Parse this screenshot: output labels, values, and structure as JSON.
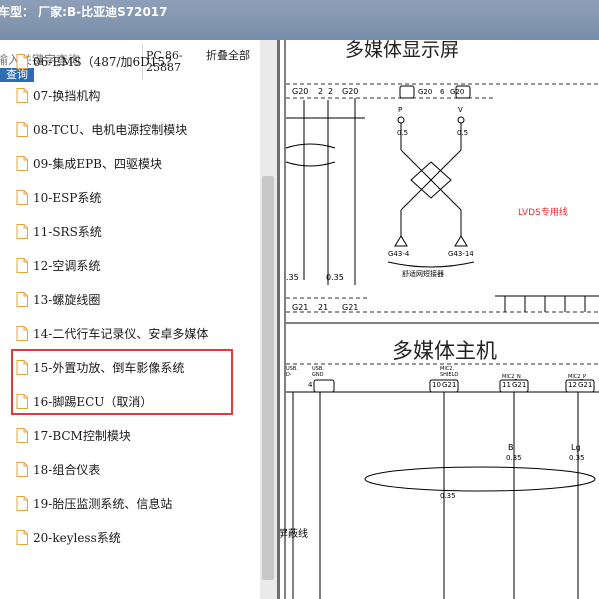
{
  "window": {
    "title": "车型：  厂家:B-比亚迪S72017"
  },
  "search": {
    "placeholder": "输入关键字查询",
    "button_label": "查询"
  },
  "header": {
    "pc_code": "PC.86-25887",
    "collapse_label": "折叠全部"
  },
  "list_items": [
    "06-EMS（487/加6D15?",
    "07-换挡机构",
    "08-TCU、电机电源控制模块",
    "09-集成EPB、四驱模块",
    "10-ESP系统",
    "11-SRS系统",
    "12-空调系统",
    "13-螺旋线圈",
    "14-二代行车记录仪、安卓多媒体",
    "15-外置功放、倒车影像系统",
    "16-脚踢ECU（取消）",
    "17-BCM控制模块",
    "18-组合仪表",
    "19-胎压监测系统、信息站",
    "20-keyless系统"
  ],
  "diagram": {
    "display_title": "多媒体显示屏",
    "host_title": "多媒体主机",
    "lvds_label": "LVDS专用线",
    "connector_left_a": "G20",
    "connector_left_b": "G20",
    "pin_2a": "2",
    "pin_2b": "2",
    "pin_p": "P",
    "pin_v": "V",
    "pin_g20_6": "G20",
    "pin_6": "6",
    "pin_g20_2": "G20",
    "wire_05_a": "0.5",
    "wire_05_b": "0.5",
    "ground_a": "G43-4",
    "ground_b": "G43-14",
    "ground_caption": "舒适网短接器",
    "wire_35_left": ".35",
    "wire_035": "0.35",
    "g21_left": "G21",
    "g21_right": "G21",
    "pin_21": "21",
    "usb_left": "USB.",
    "usb_left_b": "D-",
    "usb_gnd": "USB.",
    "usb_gnd_b": "GND",
    "pin_4": "4",
    "mic_shield": "MIC2.",
    "mic_shield_b": "SHIELD",
    "mic_n": "MIC2_N",
    "mic_p": "MIC2_P",
    "pin_10": "10",
    "pin_g21_10": "G21",
    "pin_11": "11",
    "pin_g21_11": "G21",
    "pin_12": "12",
    "pin_g21_12": "G21",
    "wire_b": "B",
    "wire_lg": "Lg",
    "wire_b_size": "0.35",
    "wire_lg_size": "0.35",
    "wire_shield_size": "0.35",
    "shield_label": "屏蔽线"
  }
}
